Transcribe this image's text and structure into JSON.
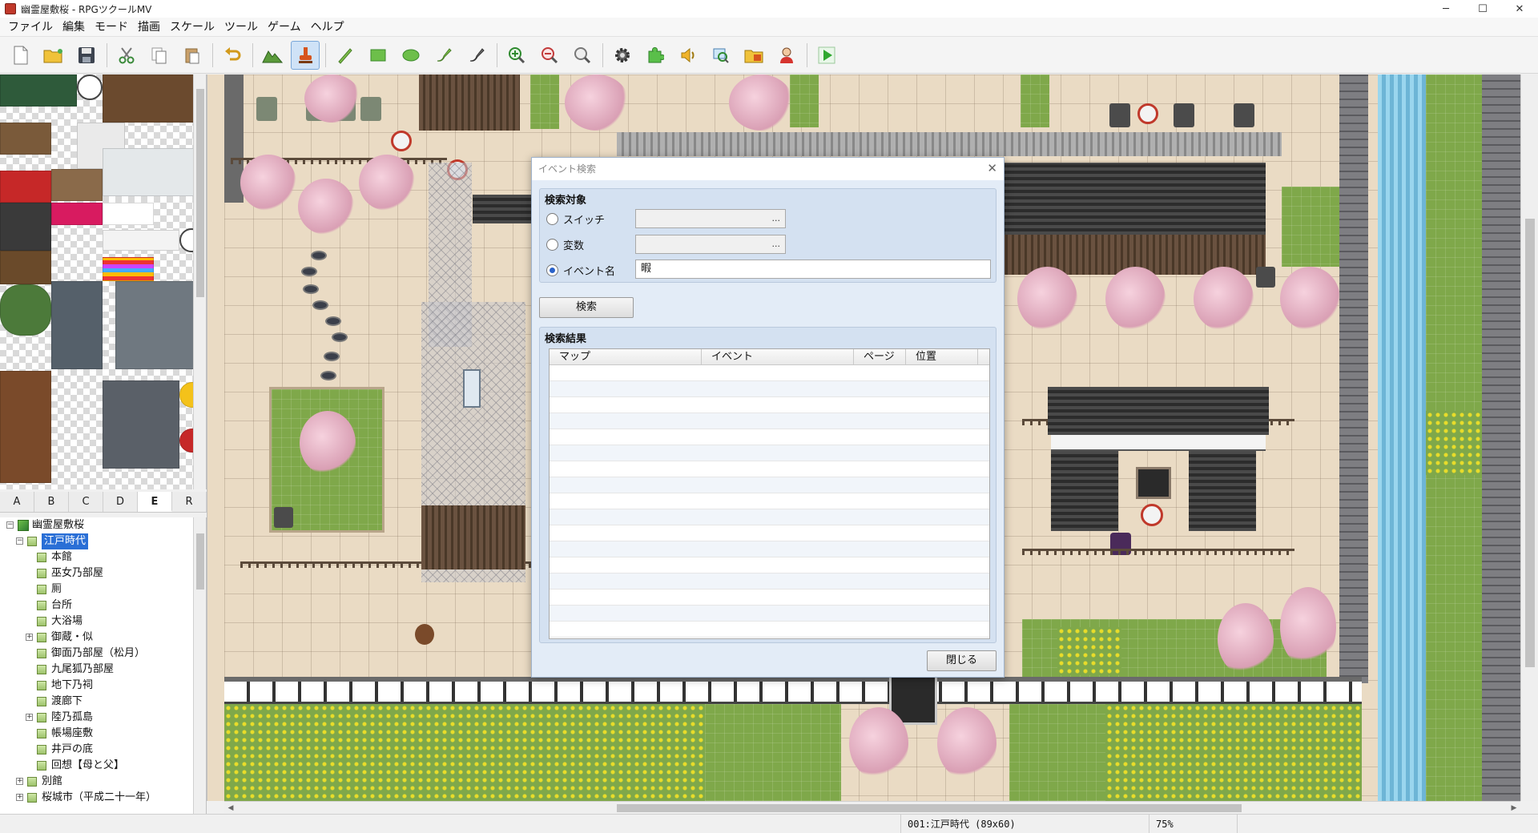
{
  "window": {
    "title": "幽霊屋敷桜 - RPGツクールMV",
    "controls": [
      "─",
      "☐",
      "✕"
    ]
  },
  "menu": [
    "ファイル",
    "編集",
    "モード",
    "描画",
    "スケール",
    "ツール",
    "ゲーム",
    "ヘルプ"
  ],
  "toolbar": {
    "groups": [
      [
        "new-project-icon",
        "open-project-icon",
        "save-project-icon"
      ],
      [
        "cut-icon",
        "copy-icon",
        "paste-icon"
      ],
      [
        "undo-icon"
      ],
      [
        "map-mode-icon",
        "event-mode-icon"
      ],
      [
        "pencil-icon",
        "rectangle-icon",
        "ellipse-icon",
        "fill-icon",
        "shadow-pen-icon"
      ],
      [
        "zoom-in-icon",
        "zoom-out-icon",
        "zoom-actual-icon"
      ],
      [
        "database-icon",
        "plugin-manager-icon",
        "sound-test-icon",
        "event-searcher-icon",
        "resource-manager-icon",
        "character-generator-icon"
      ],
      [
        "playtest-icon"
      ]
    ],
    "active": "event-mode-icon"
  },
  "tileset_tabs": {
    "tabs": [
      "A",
      "B",
      "C",
      "D",
      "E",
      "R"
    ],
    "active": "E"
  },
  "map_tree": [
    {
      "label": "幽霊屋敷桜",
      "level": 0,
      "expander": "⊟",
      "root": true
    },
    {
      "label": "江戸時代",
      "level": 1,
      "expander": "⊟",
      "selected": true
    },
    {
      "label": "本館",
      "level": 2
    },
    {
      "label": "巫女乃部屋",
      "level": 2
    },
    {
      "label": "厠",
      "level": 2
    },
    {
      "label": "台所",
      "level": 2
    },
    {
      "label": "大浴場",
      "level": 2
    },
    {
      "label": "御蔵・似",
      "level": 2,
      "expander": "⊞"
    },
    {
      "label": "御面乃部屋（松月）",
      "level": 2
    },
    {
      "label": "九尾狐乃部屋",
      "level": 2
    },
    {
      "label": "地下乃祠",
      "level": 2
    },
    {
      "label": "渡廊下",
      "level": 2
    },
    {
      "label": "陸乃孤島",
      "level": 2,
      "expander": "⊞"
    },
    {
      "label": "帳場座敷",
      "level": 2
    },
    {
      "label": "井戸の底",
      "level": 2
    },
    {
      "label": "回想【母と父】",
      "level": 2
    },
    {
      "label": "別館",
      "level": 1,
      "expander": "⊞"
    },
    {
      "label": "桜城市（平成二十一年）",
      "level": 1,
      "expander": "⊞"
    }
  ],
  "dialog": {
    "title": "イベント検索",
    "close_glyph": "✕",
    "search_target_label": "検索対象",
    "options": [
      {
        "label": "スイッチ",
        "checked": false,
        "value": "",
        "has_picker": true
      },
      {
        "label": "変数",
        "checked": false,
        "value": "",
        "has_picker": true
      },
      {
        "label": "イベント名",
        "checked": true,
        "value": "暇",
        "has_picker": false
      }
    ],
    "picker_glyph": "...",
    "search_button": "検索",
    "results_label": "検索結果",
    "columns": [
      "マップ",
      "イベント",
      "ページ",
      "位置"
    ],
    "rows": [],
    "close_button": "閉じる"
  },
  "status": {
    "map_info": "001:江戸時代 (89x60)",
    "zoom": "75%"
  },
  "colors": {
    "selection": "#2a6fd6",
    "dialog_bg": "#e3ecf7",
    "group_bg": "#d4e1f1",
    "map_floor": "#eadbc4",
    "grass": "#7fa84a"
  }
}
